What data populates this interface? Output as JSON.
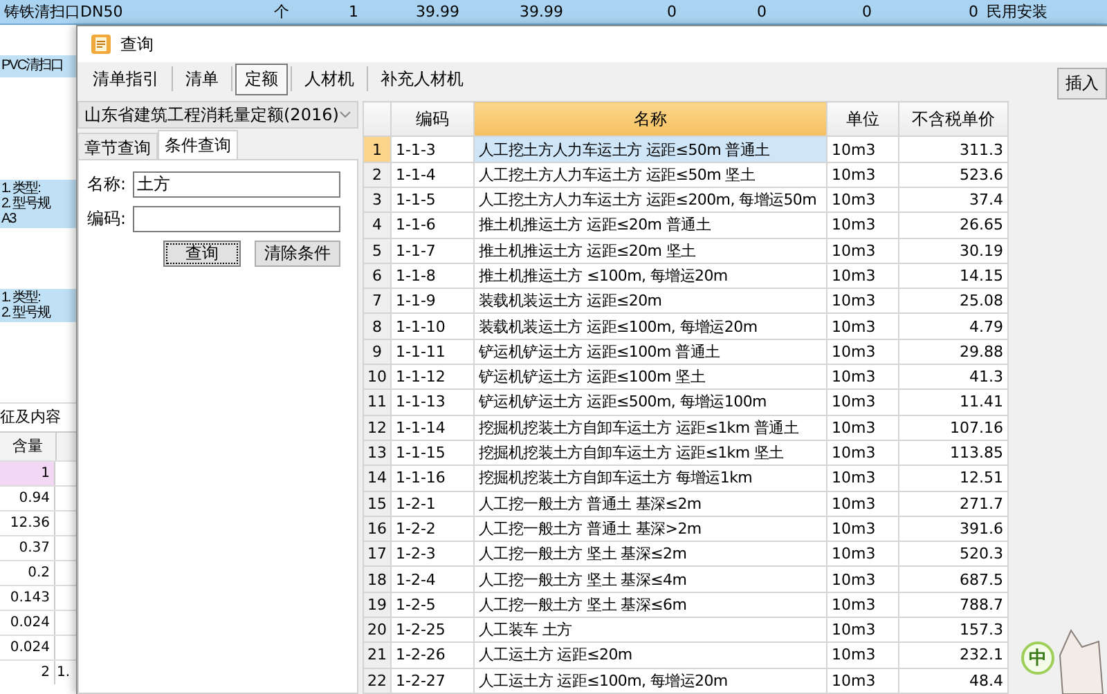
{
  "background": {
    "top_row": [
      "铸铁清扫口DN50",
      "个",
      "1",
      "39.99",
      "39.99",
      "0",
      "0",
      "0",
      "0",
      "民用安装"
    ],
    "left_items": [
      {
        "text": "PVC清扫口",
        "highlighted": true
      },
      {
        "text": "1. 类型:\n2. 型号规\nA3",
        "highlighted": true
      },
      {
        "text": "1. 类型:\n2. 型号规",
        "highlighted": true
      }
    ],
    "section_title": "征及内容",
    "quantity_header": "含量",
    "quantities": [
      {
        "value": "1",
        "selected": true
      },
      {
        "value": "0.94",
        "selected": false
      },
      {
        "value": "12.36",
        "selected": false
      },
      {
        "value": "0.37",
        "selected": false
      },
      {
        "value": "0.2",
        "selected": false
      },
      {
        "value": "0.143",
        "selected": false
      },
      {
        "value": "0.024",
        "selected": false
      },
      {
        "value": "0.024",
        "selected": false
      },
      {
        "value": "2",
        "selected": false
      }
    ],
    "column_2_cell": "1."
  },
  "dialog": {
    "title": "查询",
    "tabs": [
      {
        "label": "清单指引",
        "selected": false
      },
      {
        "label": "清单",
        "selected": false
      },
      {
        "label": "定额",
        "selected": true
      },
      {
        "label": "人材机",
        "selected": false
      },
      {
        "label": "补充人材机",
        "selected": false
      }
    ],
    "insert_button": "插入",
    "library_select": "山东省建筑工程消耗量定额(2016)",
    "search_tabs": [
      {
        "label": "章节查询",
        "selected": false
      },
      {
        "label": "条件查询",
        "selected": true
      }
    ],
    "form": {
      "name_label": "名称:",
      "name_value": "土方",
      "code_label": "编码:",
      "buttons": [
        {
          "label": "查询",
          "focused": true
        },
        {
          "label": "清除条件",
          "focused": false
        }
      ]
    },
    "table": {
      "columns": [
        {
          "label": "编码",
          "selected": false
        },
        {
          "label": "名称",
          "selected": true
        },
        {
          "label": "单位",
          "selected": false
        },
        {
          "label": "不含税单价",
          "selected": false
        }
      ],
      "rows": [
        {
          "index": "1",
          "code": "1-1-3",
          "name": "人工挖土方人力车运土方 运距≤50m 普通土",
          "unit": "10m3",
          "price": "311.3",
          "selected": true
        },
        {
          "index": "2",
          "code": "1-1-4",
          "name": "人工挖土方人力车运土方 运距≤50m 坚土",
          "unit": "10m3",
          "price": "523.6",
          "selected": false
        },
        {
          "index": "3",
          "code": "1-1-5",
          "name": "人工挖土方人力车运土方 运距≤200m, 每增运50m",
          "unit": "10m3",
          "price": "37.4",
          "selected": false
        },
        {
          "index": "4",
          "code": "1-1-6",
          "name": "推土机推运土方 运距≤20m 普通土",
          "unit": "10m3",
          "price": "26.65",
          "selected": false
        },
        {
          "index": "5",
          "code": "1-1-7",
          "name": "推土机推运土方 运距≤20m 坚土",
          "unit": "10m3",
          "price": "30.19",
          "selected": false
        },
        {
          "index": "6",
          "code": "1-1-8",
          "name": "推土机推运土方 ≤100m, 每增运20m",
          "unit": "10m3",
          "price": "14.15",
          "selected": false
        },
        {
          "index": "7",
          "code": "1-1-9",
          "name": "装载机装运土方 运距≤20m",
          "unit": "10m3",
          "price": "25.08",
          "selected": false
        },
        {
          "index": "8",
          "code": "1-1-10",
          "name": "装载机装运土方 运距≤100m, 每增运20m",
          "unit": "10m3",
          "price": "4.79",
          "selected": false
        },
        {
          "index": "9",
          "code": "1-1-11",
          "name": "铲运机铲运土方 运距≤100m 普通土",
          "unit": "10m3",
          "price": "29.88",
          "selected": false
        },
        {
          "index": "10",
          "code": "1-1-12",
          "name": "铲运机铲运土方 运距≤100m 坚土",
          "unit": "10m3",
          "price": "41.3",
          "selected": false
        },
        {
          "index": "11",
          "code": "1-1-13",
          "name": "铲运机铲运土方 运距≤500m, 每增运100m",
          "unit": "10m3",
          "price": "11.41",
          "selected": false
        },
        {
          "index": "12",
          "code": "1-1-14",
          "name": "挖掘机挖装土方自卸车运土方 运距≤1km 普通土",
          "unit": "10m3",
          "price": "107.16",
          "selected": false
        },
        {
          "index": "13",
          "code": "1-1-15",
          "name": "挖掘机挖装土方自卸车运土方 运距≤1km 坚土",
          "unit": "10m3",
          "price": "113.85",
          "selected": false
        },
        {
          "index": "14",
          "code": "1-1-16",
          "name": "挖掘机挖装土方自卸车运土方 每增运1km",
          "unit": "10m3",
          "price": "12.51",
          "selected": false
        },
        {
          "index": "15",
          "code": "1-2-1",
          "name": "人工挖一般土方 普通土 基深≤2m",
          "unit": "10m3",
          "price": "271.7",
          "selected": false
        },
        {
          "index": "16",
          "code": "1-2-2",
          "name": "人工挖一般土方 普通土 基深>2m",
          "unit": "10m3",
          "price": "391.6",
          "selected": false
        },
        {
          "index": "17",
          "code": "1-2-3",
          "name": "人工挖一般土方 坚土 基深≤2m",
          "unit": "10m3",
          "price": "520.3",
          "selected": false
        },
        {
          "index": "18",
          "code": "1-2-4",
          "name": "人工挖一般土方 坚土 基深≤4m",
          "unit": "10m3",
          "price": "687.5",
          "selected": false
        },
        {
          "index": "19",
          "code": "1-2-5",
          "name": "人工挖一般土方 坚土 基深≤6m",
          "unit": "10m3",
          "price": "788.7",
          "selected": false
        },
        {
          "index": "20",
          "code": "1-2-25",
          "name": "人工装车 土方",
          "unit": "10m3",
          "price": "157.3",
          "selected": false
        },
        {
          "index": "21",
          "code": "1-2-26",
          "name": "人工运土方 运距≤20m",
          "unit": "10m3",
          "price": "232.1",
          "selected": false
        },
        {
          "index": "22",
          "code": "1-2-27",
          "name": "人工运土方 运距≤100m, 每增运20m",
          "unit": "10m3",
          "price": "48.4",
          "selected": false
        }
      ]
    }
  },
  "ime_indicator": "中"
}
